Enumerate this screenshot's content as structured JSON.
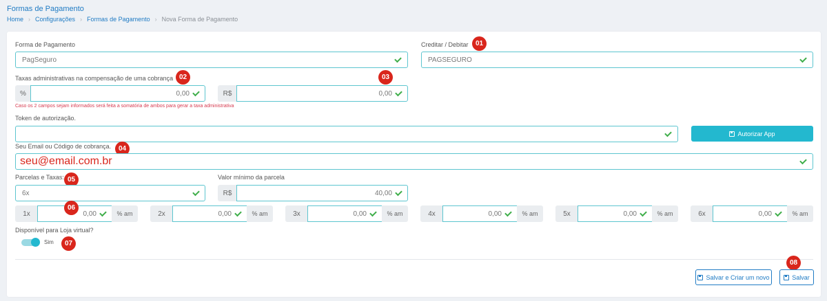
{
  "header": {
    "title": "Formas de Pagamento",
    "breadcrumb": [
      "Home",
      "Configurações",
      "Formas de Pagamento",
      "Nova Forma de Pagamento"
    ]
  },
  "form": {
    "forma_label": "Forma de Pagamento",
    "forma_value": "PagSeguro",
    "creditar_label": "Creditar / Debitar",
    "creditar_value": "PAGSEGURO",
    "taxas_label": "Taxas administrativas na compensação de uma cobrança",
    "taxa_pct_addon": "%",
    "taxa_pct_value": "0,00",
    "taxa_rs_addon": "R$",
    "taxa_rs_value": "0,00",
    "taxas_hint": "Caso os 2 campos sejam informados será feita a somatória de ambos para gerar a taxa administrativa",
    "token_label": "Token de autorização.",
    "token_value": "",
    "autorizar_label": "Autorizar App",
    "email_label": "Seu Email ou Código de cobrança.",
    "email_value": "seu@email.com.br",
    "parcelas_label": "Parcelas e Taxas:",
    "parcelas_value": "6x",
    "valor_min_label": "Valor mínimo da parcela",
    "valor_min_addon": "R$",
    "valor_min_value": "40,00",
    "installments": [
      {
        "label": "1x",
        "value": "0,00",
        "suffix": "% am"
      },
      {
        "label": "2x",
        "value": "0,00",
        "suffix": "% am"
      },
      {
        "label": "3x",
        "value": "0,00",
        "suffix": "% am"
      },
      {
        "label": "4x",
        "value": "0,00",
        "suffix": "% am"
      },
      {
        "label": "5x",
        "value": "0,00",
        "suffix": "% am"
      },
      {
        "label": "6x",
        "value": "0,00",
        "suffix": "% am"
      }
    ],
    "loja_label": "Disponível para Loja virtual?",
    "loja_toggle_text": "Sim",
    "loja_toggle_on": true
  },
  "actions": {
    "save_new_label": "Salvar e Criar um novo",
    "save_label": "Salvar"
  },
  "badges": [
    "01",
    "02",
    "03",
    "04",
    "05",
    "06",
    "07",
    "08"
  ],
  "colors": {
    "accent": "#1f7bc4",
    "teal": "#23b8cf",
    "field_border": "#5cc5cf",
    "check": "#3fae4a",
    "badge": "#d9261c",
    "hint": "#d63a4f"
  },
  "icons": {
    "valid": "check-icon",
    "save": "floppy-disk-icon",
    "breadcrumb_sep": "chevron-right-icon"
  }
}
